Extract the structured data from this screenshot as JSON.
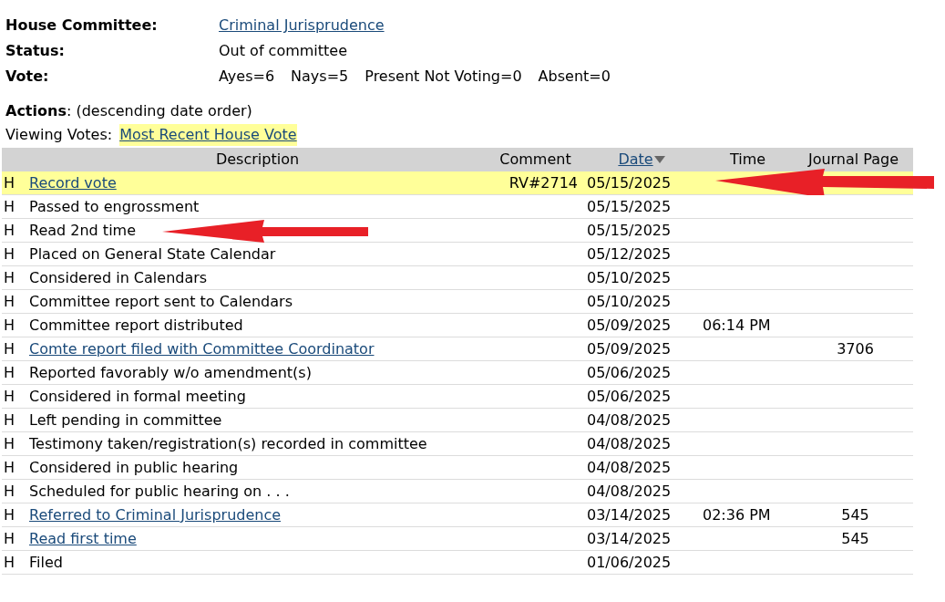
{
  "info": [
    {
      "label": "House Committee:",
      "value": "Criminal Jurisprudence",
      "link": true
    },
    {
      "label": "Status:",
      "value": "Out of committee",
      "link": false
    },
    {
      "label": "Vote:",
      "values": [
        "Ayes=6",
        "Nays=5",
        "Present Not Voting=0",
        "Absent=0"
      ]
    }
  ],
  "actions": {
    "label": "Actions",
    "note": ": (descending date order)"
  },
  "viewing": {
    "label": "Viewing Votes:",
    "link": "Most Recent House Vote"
  },
  "table": {
    "columns": [
      {
        "label": "Description",
        "sorted": false
      },
      {
        "label": "Comment",
        "sorted": false
      },
      {
        "label": "Date",
        "sorted": true
      },
      {
        "label": "Time",
        "sorted": false
      },
      {
        "label": "Journal Page",
        "sorted": false
      }
    ],
    "rows": [
      {
        "chamber": "H",
        "description": "Record vote",
        "link": true,
        "comment": "RV#2714",
        "date": "05/15/2025",
        "time": "",
        "journal_page": "",
        "selected": true,
        "arrow": true
      },
      {
        "chamber": "H",
        "description": "Passed to engrossment",
        "link": false,
        "comment": "",
        "date": "05/15/2025",
        "time": "",
        "journal_page": "",
        "selected": false,
        "arrow": false
      },
      {
        "chamber": "H",
        "description": "Read 2nd time",
        "link": false,
        "comment": "",
        "date": "05/15/2025",
        "time": "",
        "journal_page": "",
        "selected": false,
        "arrow": true
      },
      {
        "chamber": "H",
        "description": "Placed on General State Calendar",
        "link": false,
        "comment": "",
        "date": "05/12/2025",
        "time": "",
        "journal_page": "",
        "selected": false,
        "arrow": false
      },
      {
        "chamber": "H",
        "description": "Considered in Calendars",
        "link": false,
        "comment": "",
        "date": "05/10/2025",
        "time": "",
        "journal_page": "",
        "selected": false,
        "arrow": false
      },
      {
        "chamber": "H",
        "description": "Committee report sent to Calendars",
        "link": false,
        "comment": "",
        "date": "05/10/2025",
        "time": "",
        "journal_page": "",
        "selected": false,
        "arrow": false
      },
      {
        "chamber": "H",
        "description": "Committee report distributed",
        "link": false,
        "comment": "",
        "date": "05/09/2025",
        "time": "06:14 PM",
        "journal_page": "",
        "selected": false,
        "arrow": false
      },
      {
        "chamber": "H",
        "description": "Comte report filed with Committee Coordinator",
        "link": true,
        "comment": "",
        "date": "05/09/2025",
        "time": "",
        "journal_page": "3706",
        "selected": false,
        "arrow": false
      },
      {
        "chamber": "H",
        "description": "Reported favorably w/o amendment(s)",
        "link": false,
        "comment": "",
        "date": "05/06/2025",
        "time": "",
        "journal_page": "",
        "selected": false,
        "arrow": false
      },
      {
        "chamber": "H",
        "description": "Considered in formal meeting",
        "link": false,
        "comment": "",
        "date": "05/06/2025",
        "time": "",
        "journal_page": "",
        "selected": false,
        "arrow": false
      },
      {
        "chamber": "H",
        "description": "Left pending in committee",
        "link": false,
        "comment": "",
        "date": "04/08/2025",
        "time": "",
        "journal_page": "",
        "selected": false,
        "arrow": false
      },
      {
        "chamber": "H",
        "description": "Testimony taken/registration(s) recorded in committee",
        "link": false,
        "comment": "",
        "date": "04/08/2025",
        "time": "",
        "journal_page": "",
        "selected": false,
        "arrow": false
      },
      {
        "chamber": "H",
        "description": "Considered in public hearing",
        "link": false,
        "comment": "",
        "date": "04/08/2025",
        "time": "",
        "journal_page": "",
        "selected": false,
        "arrow": false
      },
      {
        "chamber": "H",
        "description": "Scheduled for public hearing on . . .",
        "link": false,
        "comment": "",
        "date": "04/08/2025",
        "time": "",
        "journal_page": "",
        "selected": false,
        "arrow": false
      },
      {
        "chamber": "H",
        "description": "Referred to Criminal Jurisprudence",
        "link": true,
        "comment": "",
        "date": "03/14/2025",
        "time": "02:36 PM",
        "journal_page": "545",
        "selected": false,
        "arrow": false
      },
      {
        "chamber": "H",
        "description": "Read first time",
        "link": true,
        "comment": "",
        "date": "03/14/2025",
        "time": "",
        "journal_page": "545",
        "selected": false,
        "arrow": false
      },
      {
        "chamber": "H",
        "description": "Filed",
        "link": false,
        "comment": "",
        "date": "01/06/2025",
        "time": "",
        "journal_page": "",
        "selected": false,
        "arrow": false
      }
    ]
  }
}
